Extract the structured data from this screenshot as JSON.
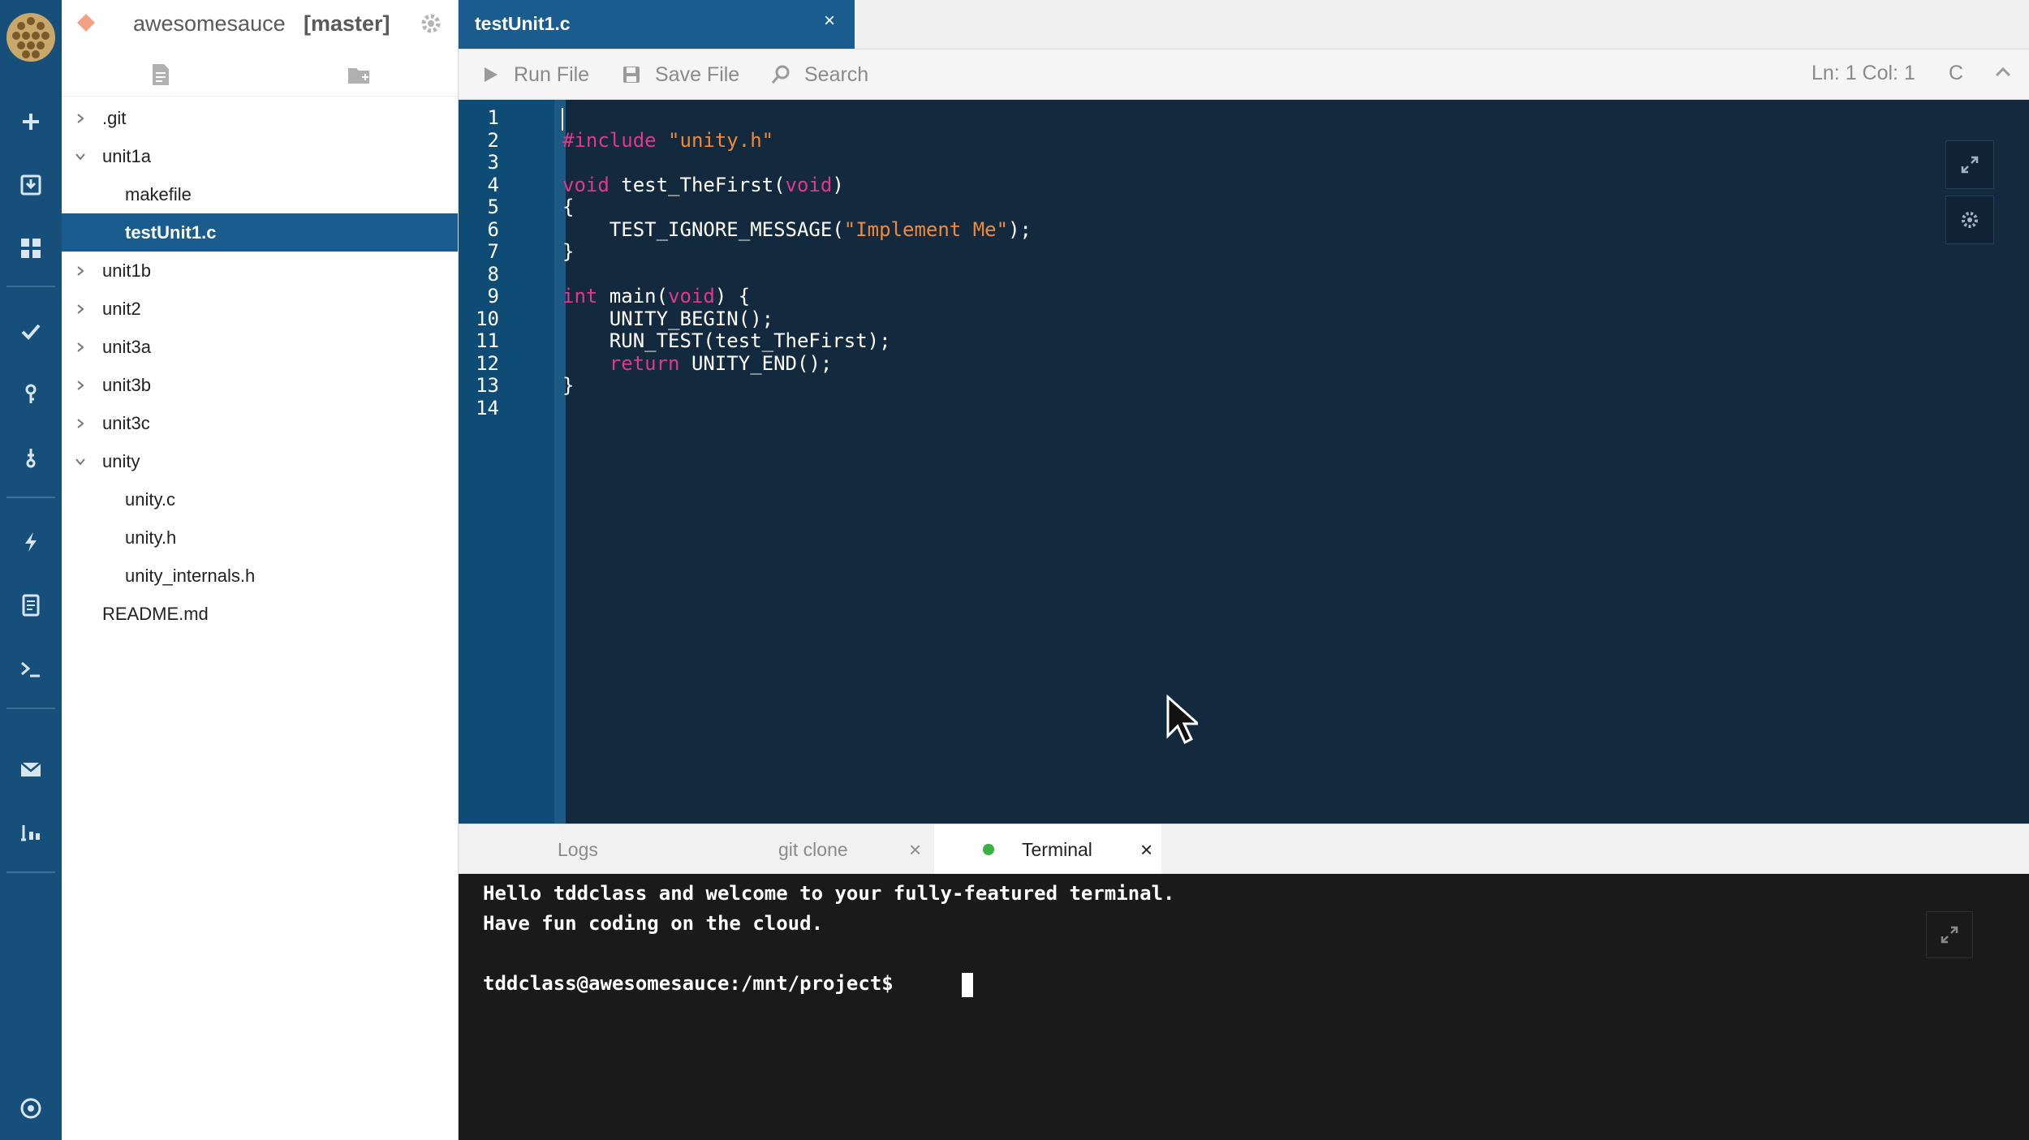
{
  "project": {
    "name": "awesomesauce",
    "branch": "[master]"
  },
  "file_tree": [
    {
      "label": ".git",
      "expand": "collapsed",
      "depth": 0
    },
    {
      "label": "unit1a",
      "expand": "expanded",
      "depth": 0
    },
    {
      "label": "makefile",
      "expand": "none",
      "depth": 1
    },
    {
      "label": "testUnit1.c",
      "expand": "none",
      "depth": 1,
      "selected": true
    },
    {
      "label": "unit1b",
      "expand": "collapsed",
      "depth": 0
    },
    {
      "label": "unit2",
      "expand": "collapsed",
      "depth": 0
    },
    {
      "label": "unit3a",
      "expand": "collapsed",
      "depth": 0
    },
    {
      "label": "unit3b",
      "expand": "collapsed",
      "depth": 0
    },
    {
      "label": "unit3c",
      "expand": "collapsed",
      "depth": 0
    },
    {
      "label": "unity",
      "expand": "expanded",
      "depth": 0
    },
    {
      "label": "unity.c",
      "expand": "none",
      "depth": 1
    },
    {
      "label": "unity.h",
      "expand": "none",
      "depth": 1
    },
    {
      "label": "unity_internals.h",
      "expand": "none",
      "depth": 1
    },
    {
      "label": "README.md",
      "expand": "none",
      "depth": 0
    }
  ],
  "editor_tab": {
    "label": "testUnit1.c",
    "close": "×"
  },
  "toolbar": {
    "run_label": "Run File",
    "save_label": "Save File",
    "search_label": "Search",
    "position": "Ln: 1 Col: 1",
    "language": "C"
  },
  "code": {
    "line_numbers": [
      "1",
      "2",
      "3",
      "4",
      "5",
      "6",
      "7",
      "8",
      "9",
      "10",
      "11",
      "12",
      "13",
      "14"
    ],
    "lines": [
      [],
      [
        {
          "t": "#include ",
          "c": "pre"
        },
        {
          "t": "\"unity.h\"",
          "c": "str"
        }
      ],
      [],
      [
        {
          "t": "void",
          "c": "kw"
        },
        {
          "t": " test_TheFirst(",
          "c": ""
        },
        {
          "t": "void",
          "c": "kw"
        },
        {
          "t": ")",
          "c": ""
        }
      ],
      [
        {
          "t": "{",
          "c": ""
        }
      ],
      [
        {
          "t": "    TEST_IGNORE_MESSAGE(",
          "c": ""
        },
        {
          "t": "\"Implement Me\"",
          "c": "str"
        },
        {
          "t": ");",
          "c": ""
        }
      ],
      [
        {
          "t": "}",
          "c": ""
        }
      ],
      [],
      [
        {
          "t": "int",
          "c": "kw"
        },
        {
          "t": " main(",
          "c": ""
        },
        {
          "t": "void",
          "c": "kw"
        },
        {
          "t": ") {",
          "c": ""
        }
      ],
      [
        {
          "t": "    UNITY_BEGIN();",
          "c": ""
        }
      ],
      [
        {
          "t": "    RUN_TEST(test_TheFirst);",
          "c": ""
        }
      ],
      [
        {
          "t": "    ",
          "c": ""
        },
        {
          "t": "return",
          "c": "kw"
        },
        {
          "t": " UNITY_END();",
          "c": ""
        }
      ],
      [
        {
          "t": "}",
          "c": ""
        }
      ],
      []
    ]
  },
  "bottom_panel": {
    "tabs": [
      {
        "label": "Logs"
      },
      {
        "label": "git clone",
        "close": "×"
      },
      {
        "label": "Terminal",
        "close": "×",
        "active": true
      }
    ]
  },
  "terminal": {
    "lines": [
      "Hello tddclass and welcome to your fully-featured terminal.",
      "Have fun coding on the cloud.",
      "",
      "tddclass@awesomesauce:/mnt/project$ "
    ]
  },
  "colors": {
    "rail": "#16507a",
    "accent": "#1a5c8e",
    "editor_bg": "#132a3e",
    "gutter": "#0f4c75",
    "keyword": "#e0388b",
    "string": "#f08a3a",
    "terminal_bg": "#1a1a1a",
    "terminal_status": "#3cb043"
  }
}
